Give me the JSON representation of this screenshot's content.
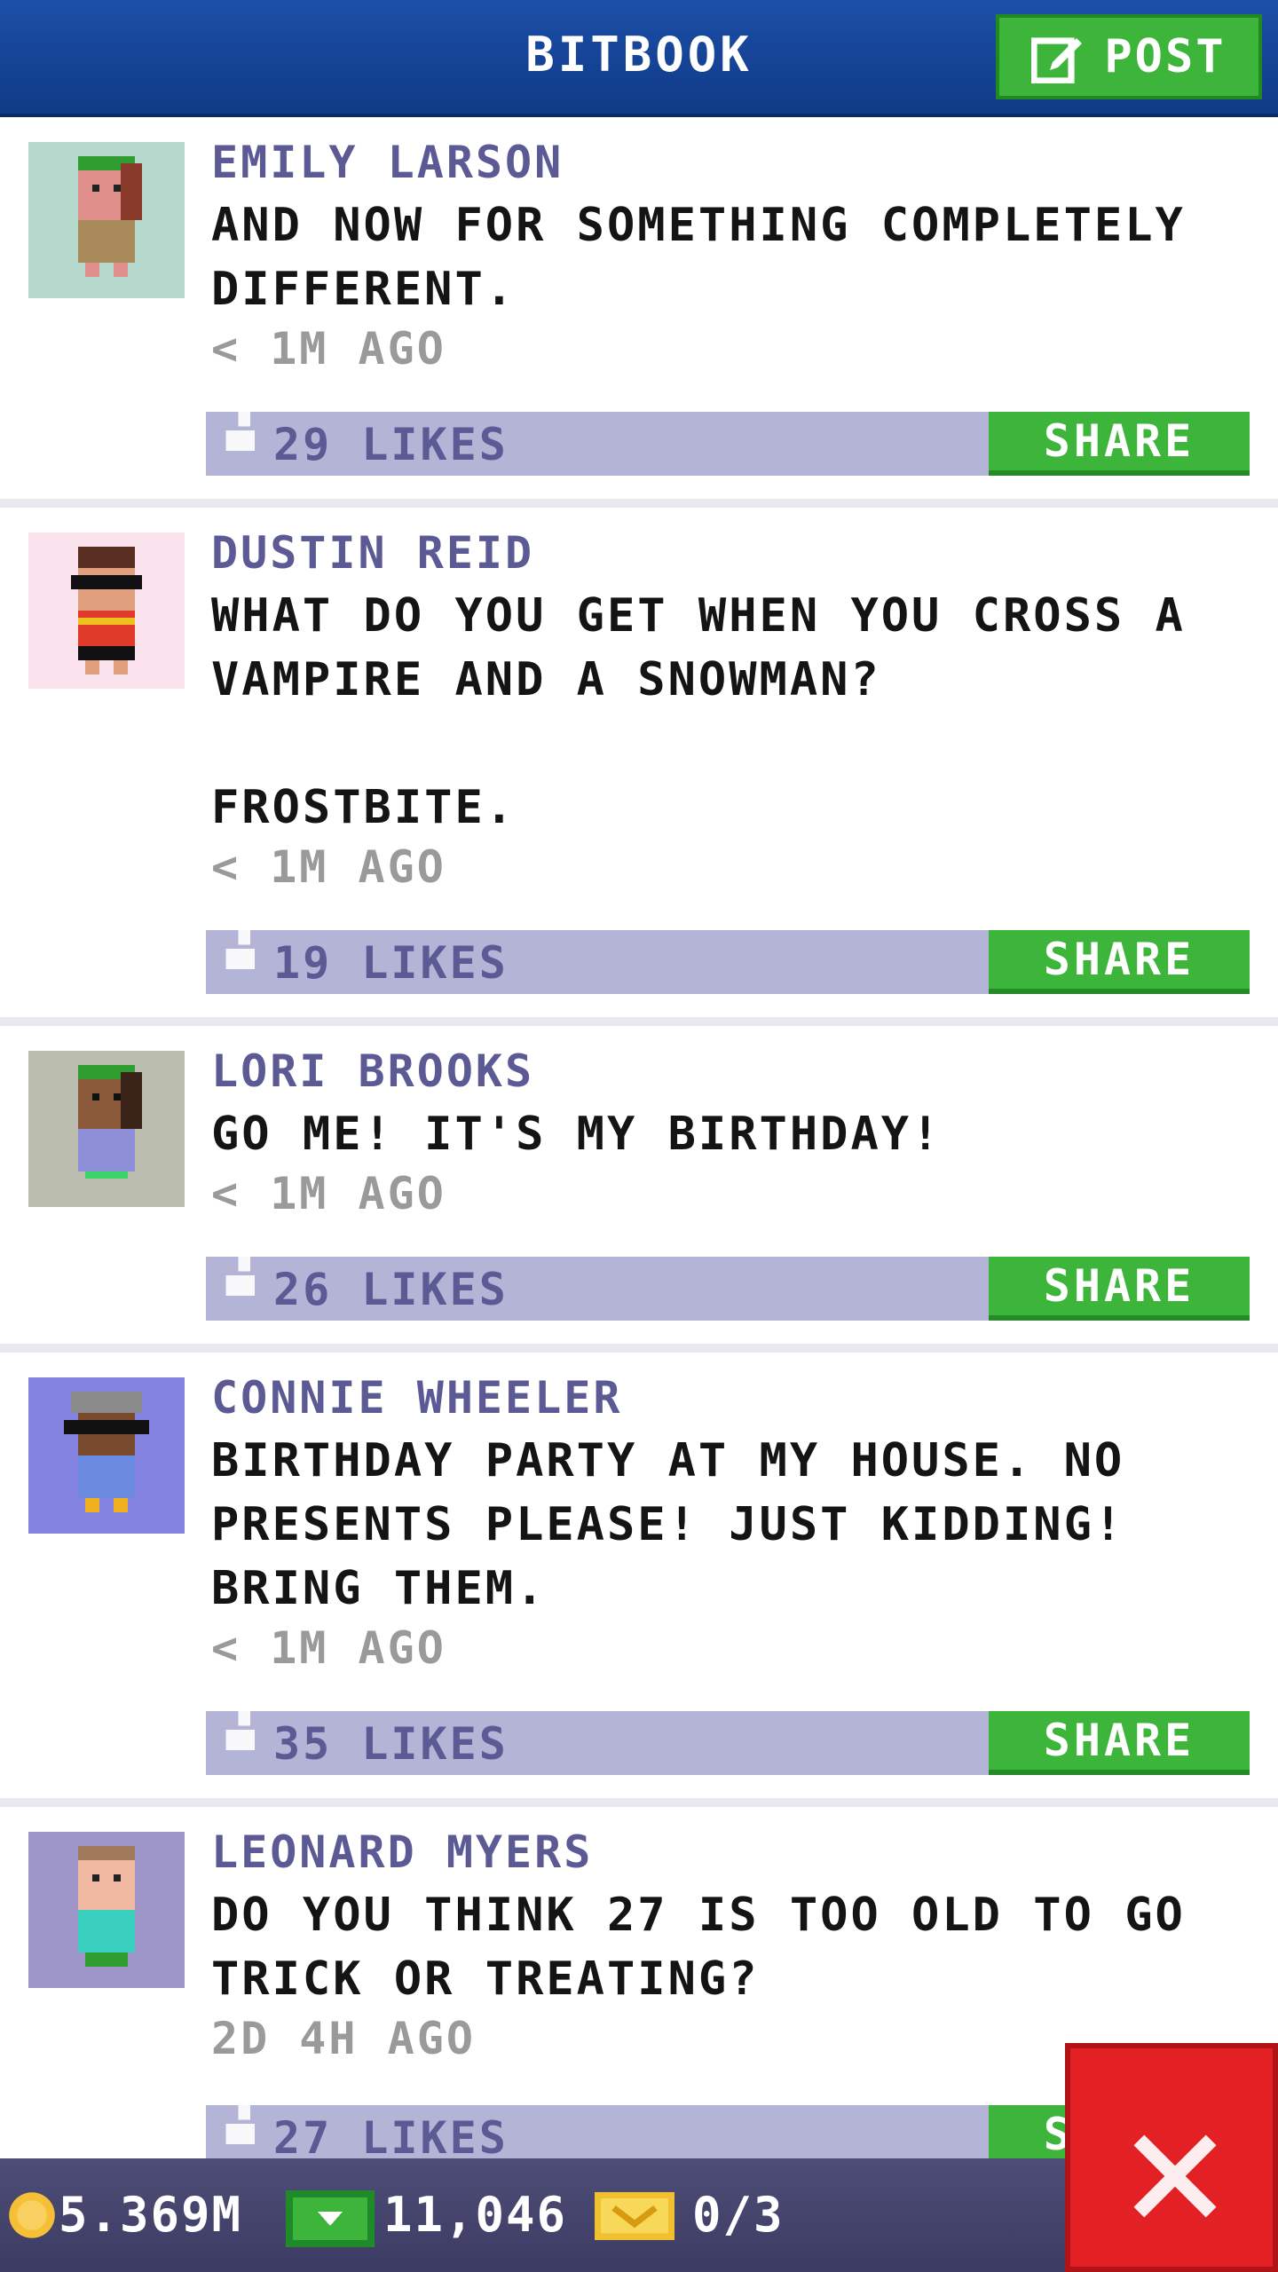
{
  "header": {
    "title": "BITBOOK",
    "post_label": "POST"
  },
  "posts": [
    {
      "name": "EMILY LARSON",
      "text": "AND NOW FOR SOMETHING COMPLETELY\nDIFFERENT.",
      "time": "< 1M AGO",
      "likes": "29 LIKES",
      "share": "SHARE",
      "avatar_bg": "#b4d8cc"
    },
    {
      "name": "DUSTIN REID",
      "text": "WHAT DO YOU GET WHEN YOU CROSS A\nVAMPIRE AND A SNOWMAN?\n\nFROSTBITE.",
      "time": "< 1M AGO",
      "likes": "19 LIKES",
      "share": "SHARE",
      "avatar_bg": "#f9e2ec"
    },
    {
      "name": "LORI BROOKS",
      "text": "GO ME! IT'S MY BIRTHDAY!",
      "time": "< 1M AGO",
      "likes": "26 LIKES",
      "share": "SHARE",
      "avatar_bg": "#babcae"
    },
    {
      "name": "CONNIE WHEELER",
      "text": "BIRTHDAY PARTY AT MY HOUSE. NO\nPRESENTS PLEASE! JUST KIDDING!\nBRING THEM.",
      "time": "< 1M AGO",
      "likes": "35 LIKES",
      "share": "SHARE",
      "avatar_bg": "#8482e0"
    },
    {
      "name": "LEONARD MYERS",
      "text": "DO YOU THINK 27 IS TOO OLD TO GO\nTRICK OR TREATING?",
      "time": "2D 4H AGO",
      "likes": "27 LIKES",
      "share": "SHARE",
      "avatar_bg": "#9e96c8"
    }
  ],
  "footer": {
    "coins": "5.369M",
    "bux": "11,046",
    "tickets": "0/3"
  },
  "colors": {
    "header": "#1a4da6",
    "accent_green": "#3cb53a",
    "likes_bar": "#b3b4d6",
    "name": "#5b5a95",
    "close": "#e32125"
  }
}
